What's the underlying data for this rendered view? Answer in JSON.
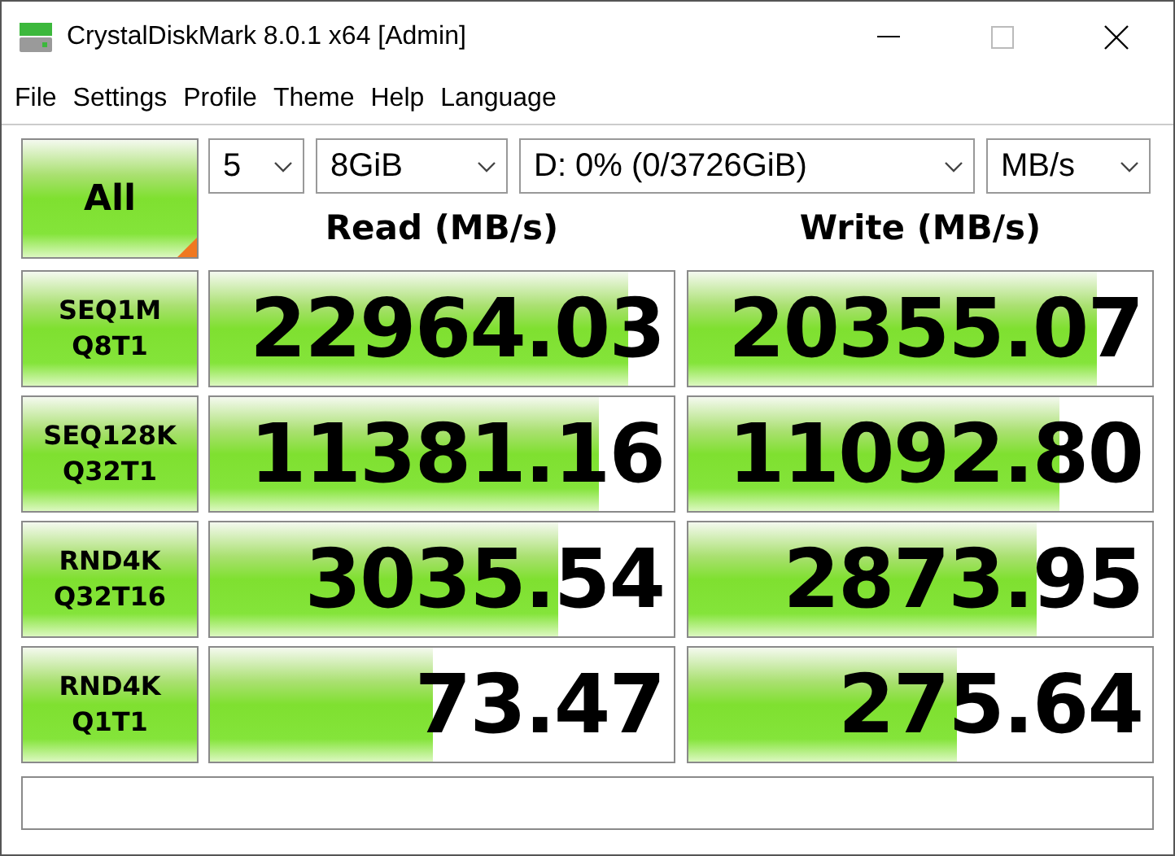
{
  "window": {
    "title": "CrystalDiskMark 8.0.1 x64 [Admin]"
  },
  "menu": [
    "File",
    "Settings",
    "Profile",
    "Theme",
    "Help",
    "Language"
  ],
  "all_button": {
    "label": "All"
  },
  "selects": [
    {
      "value": "5"
    },
    {
      "value": "8GiB"
    },
    {
      "value": "D: 0% (0/3726GiB)"
    },
    {
      "value": "MB/s"
    }
  ],
  "columns": [
    "Read (MB/s)",
    "Write (MB/s)"
  ],
  "rows": [
    {
      "test": "SEQ1M",
      "params": "Q8T1",
      "read": {
        "value": "22964.03",
        "level": 0.9
      },
      "write": {
        "value": "20355.07",
        "level": 0.88
      }
    },
    {
      "test": "SEQ128K",
      "params": "Q32T1",
      "read": {
        "value": "11381.16",
        "level": 0.84
      },
      "write": {
        "value": "11092.80",
        "level": 0.8
      }
    },
    {
      "test": "RND4K",
      "params": "Q32T16",
      "read": {
        "value": "3035.54",
        "level": 0.75
      },
      "write": {
        "value": "2873.95",
        "level": 0.75
      }
    },
    {
      "test": "RND4K",
      "params": "Q1T1",
      "read": {
        "value": "73.47",
        "level": 0.48
      },
      "write": {
        "value": "275.64",
        "level": 0.58
      }
    }
  ]
}
